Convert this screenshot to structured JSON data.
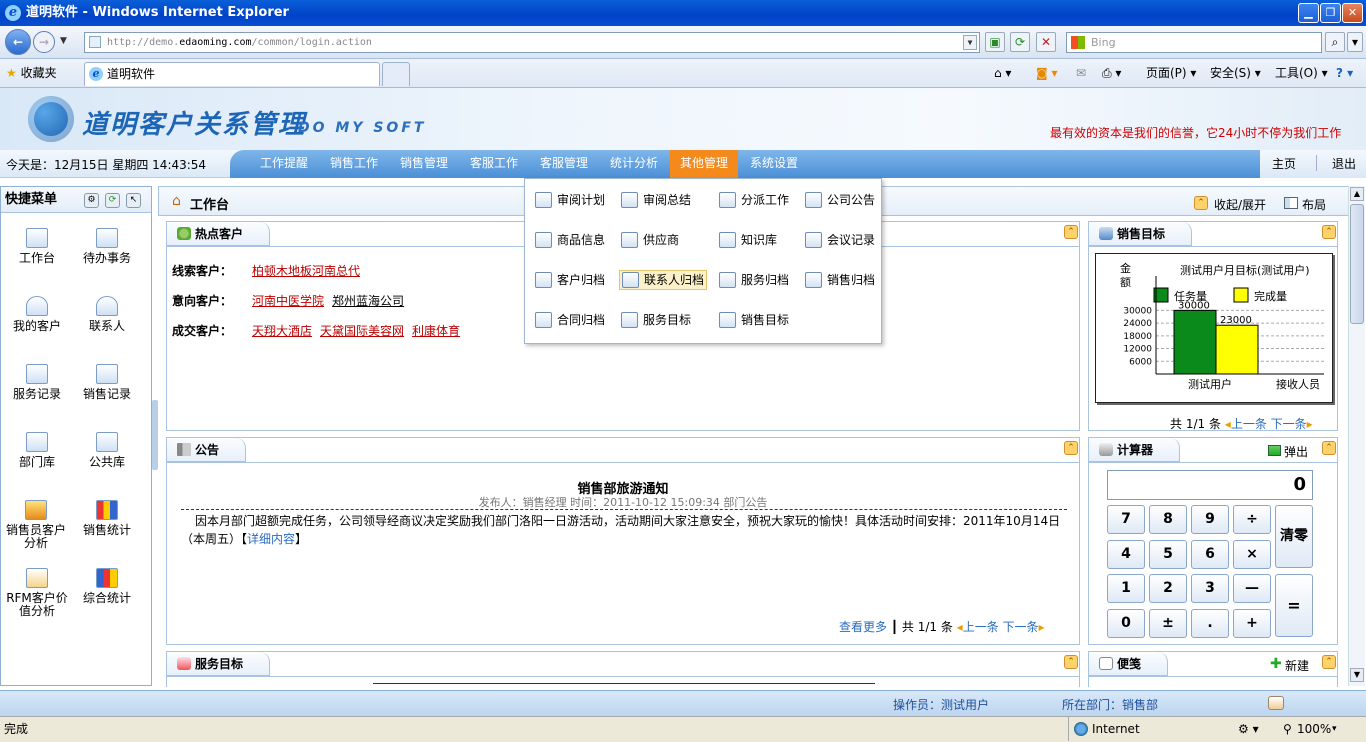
{
  "browser": {
    "title": "道明软件 - Windows Internet Explorer",
    "url_prefix": "http://demo.",
    "url_domain": "edaoming.com",
    "url_path": "/common/login.action",
    "search_placeholder": "Bing",
    "favorites_label": "收藏夹",
    "tab_title": "道明软件",
    "cmd_page": "页面(P)",
    "cmd_safety": "安全(S)",
    "cmd_tools": "工具(O)",
    "status_text": "完成",
    "zone": "Internet",
    "zoom": "100%"
  },
  "app": {
    "logo_cn": "道明客户关系管理",
    "logo_en": "DO MY SOFT",
    "slogan": "最有效的资本是我们的信誉，它24小时不停为我们工作",
    "datetime": "今天是：12月15日 星期四 14:43:54",
    "menu": [
      "工作提醒",
      "销售工作",
      "销售管理",
      "客服工作",
      "客服管理",
      "统计分析",
      "其他管理",
      "系统设置"
    ],
    "home": "主页",
    "logout": "退出"
  },
  "quick_menu": {
    "title": "快捷菜单",
    "items": [
      "工作台",
      "待办事务",
      "我的客户",
      "联系人",
      "服务记录",
      "销售记录",
      "部门库",
      "公共库",
      "销售员客户分析",
      "销售统计",
      "RFM客户价值分析",
      "综合统计"
    ]
  },
  "workspace": {
    "title": "工作台",
    "toggle": "收起/展开",
    "layout": "布局"
  },
  "hot_customers": {
    "title": "热点客户",
    "rows": [
      {
        "label": "线索客户：",
        "links": [
          "柏顿木地板河南总代"
        ]
      },
      {
        "label": "意向客户：",
        "links": [
          "河南中医学院",
          "郑州蓝海公司"
        ]
      },
      {
        "label": "成交客户：",
        "links": [
          "天翔大酒店",
          "天黛国际美容网",
          "利康体育"
        ]
      }
    ]
  },
  "notice": {
    "title": "公告",
    "headline": "销售部旅游通知",
    "meta": "发布人：销售经理   时间：2011-10-12 15:09:34   部门公告",
    "body": "因本月部门超额完成任务，公司领导经商议决定奖励我们部门洛阳一日游活动，活动期间大家注意安全，预祝大家玩的愉快！具体活动时间安排：2011年10月14日（本周五）【",
    "detail": "详细内容",
    "body_end": "】",
    "more": "查看更多",
    "pager": "共 1/1 条",
    "prev": "上一条",
    "next": "下一条"
  },
  "service_target": {
    "title": "服务目标"
  },
  "sales_target": {
    "title": "销售目标",
    "pager": "共 1/1 条",
    "prev": "上一条",
    "next": "下一条"
  },
  "chart_data": {
    "type": "bar",
    "title": "测试用户月目标(测试用户)",
    "ylabel": "金额",
    "xlabel": "接收人员",
    "categories": [
      "测试用户"
    ],
    "series": [
      {
        "name": "任务量",
        "values": [
          30000
        ],
        "color": "#0a8a1a"
      },
      {
        "name": "完成量",
        "values": [
          23000
        ],
        "color": "#ffff00"
      }
    ],
    "yticks": [
      6000,
      12000,
      18000,
      24000,
      30000
    ],
    "ylim": [
      0,
      33000
    ]
  },
  "calculator": {
    "title": "计算器",
    "popout": "弹出",
    "display": "0",
    "keys": [
      "7",
      "8",
      "9",
      "÷",
      "4",
      "5",
      "6",
      "×",
      "1",
      "2",
      "3",
      "—",
      "0",
      "±",
      ".",
      "+"
    ],
    "clear": "清零",
    "equals": "="
  },
  "notes": {
    "title": "便笺",
    "new": "新建"
  },
  "dropdown": {
    "items": [
      "审阅计划",
      "审阅总结",
      "分派工作",
      "公司公告",
      "商品信息",
      "供应商",
      "知识库",
      "会议记录",
      "客户归档",
      "联系人归档",
      "服务归档",
      "销售归档",
      "合同归档",
      "服务目标",
      "销售目标"
    ]
  },
  "footer": {
    "operator": "操作员：测试用户",
    "dept": "所在部门：销售部"
  },
  "colors": {
    "accent": "#f48a1c",
    "brand": "#1d66b7",
    "link": "#b00000"
  }
}
